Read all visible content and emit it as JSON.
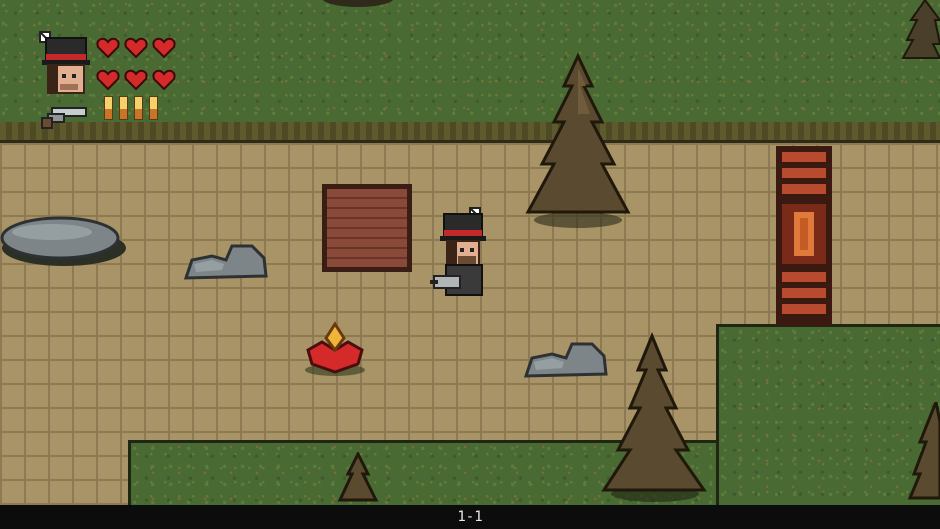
{
  "level": {
    "label": "1-1"
  },
  "player": {
    "hearts": [
      {
        "state": "full"
      },
      {
        "state": "full"
      },
      {
        "state": "full"
      },
      {
        "state": "full"
      },
      {
        "state": "full"
      },
      {
        "state": "full"
      }
    ],
    "ammo_count": 4
  },
  "world": {
    "objects": [
      {
        "kind": "tree"
      },
      {
        "kind": "crate"
      },
      {
        "kind": "rock"
      },
      {
        "kind": "door"
      },
      {
        "kind": "boulder"
      },
      {
        "kind": "health-pickup"
      }
    ]
  },
  "colors": {
    "grass": "#4a6a34",
    "path": "#a89466",
    "heart": "#d42a2a",
    "status_bar": "#0c0c0c",
    "status_text": "#e8e8e8"
  }
}
